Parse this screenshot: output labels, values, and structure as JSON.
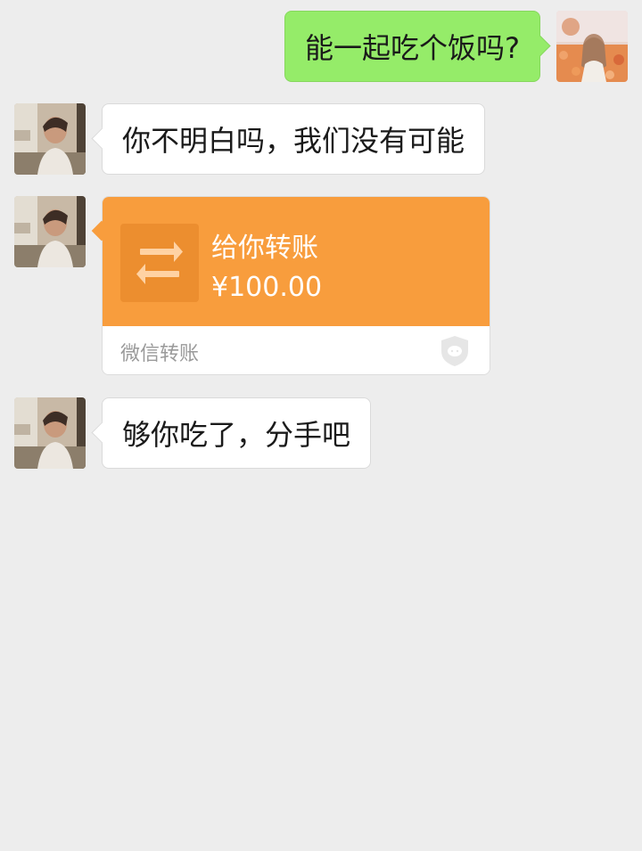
{
  "messages": [
    {
      "direction": "outgoing",
      "text": "能一起吃个饭吗?"
    },
    {
      "direction": "incoming",
      "text": "你不明白吗，我们没有可能"
    },
    {
      "direction": "incoming",
      "type": "transfer",
      "title": "给你转账",
      "amount": "¥100.00",
      "footer": "微信转账"
    },
    {
      "direction": "incoming",
      "text": "够你吃了，分手吧"
    }
  ],
  "colors": {
    "background": "#ededed",
    "outgoing_bubble": "#95ec69",
    "incoming_bubble": "#ffffff",
    "transfer_orange": "#f89d3d"
  },
  "icons": {
    "transfer": "transfer-arrows-icon",
    "shield": "shield-icon"
  }
}
